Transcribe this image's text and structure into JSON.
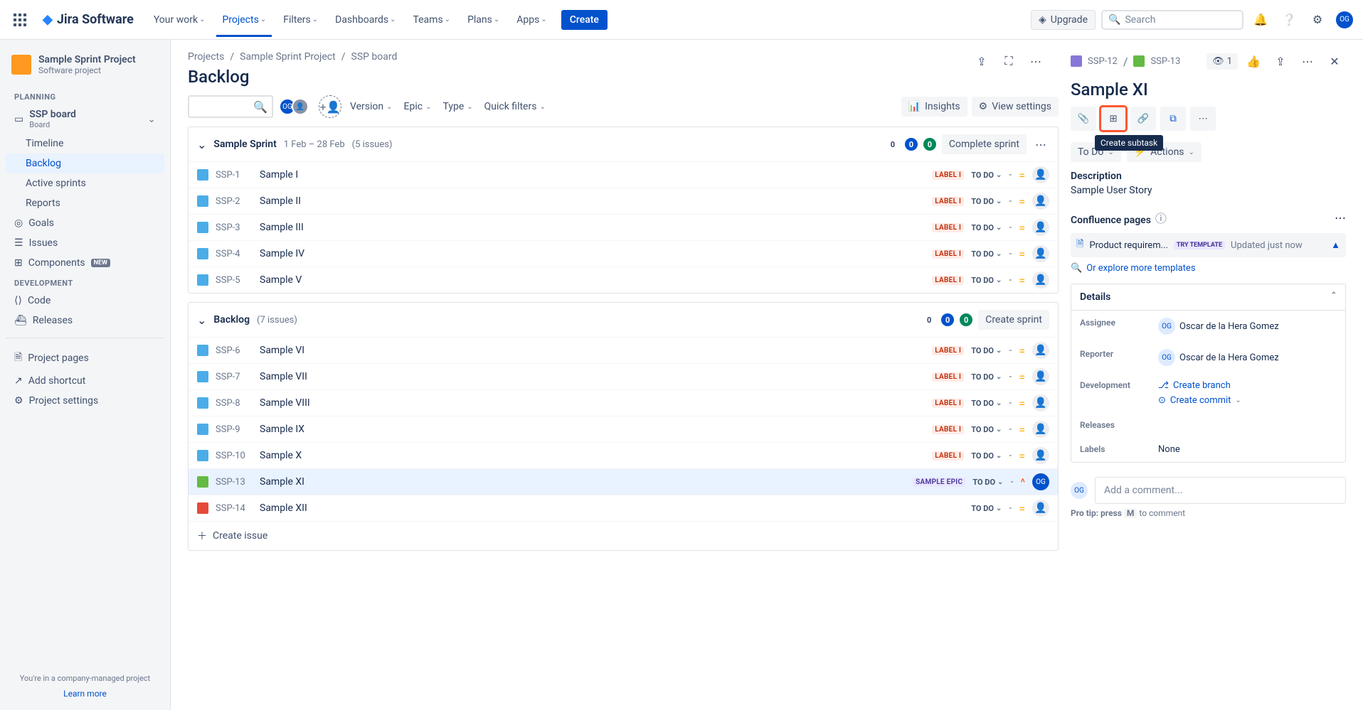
{
  "nav": {
    "logo_text": "Jira Software",
    "items": [
      "Your work",
      "Projects",
      "Filters",
      "Dashboards",
      "Teams",
      "Plans",
      "Apps"
    ],
    "active_index": 1,
    "create": "Create",
    "upgrade": "Upgrade",
    "search_placeholder": "Search"
  },
  "sidebar": {
    "project_name": "Sample Sprint Project",
    "project_sub": "Software project",
    "sections": {
      "planning": {
        "label": "PLANNING",
        "board_group": "SSP board",
        "board_sub": "Board",
        "items": [
          "Timeline",
          "Backlog",
          "Active sprints",
          "Reports"
        ],
        "selected": "Backlog",
        "goals": "Goals",
        "issues": "Issues",
        "components": "Components",
        "components_badge": "NEW"
      },
      "development": {
        "label": "DEVELOPMENT",
        "items": [
          "Code",
          "Releases"
        ]
      },
      "bottom": [
        "Project pages",
        "Add shortcut",
        "Project settings"
      ]
    },
    "footer_line": "You're in a company-managed project",
    "learn_more": "Learn more"
  },
  "breadcrumbs": [
    "Projects",
    "Sample Sprint Project",
    "SSP board"
  ],
  "page_title": "Backlog",
  "toolbar": {
    "filters": [
      "Version",
      "Epic",
      "Type",
      "Quick filters"
    ],
    "insights": "Insights",
    "view_settings": "View settings"
  },
  "sprints": [
    {
      "name": "Sample Sprint",
      "dates": "1 Feb – 28 Feb",
      "issue_count_label": "(5 issues)",
      "counts": {
        "todo": "0",
        "inprog": "0",
        "done": "0"
      },
      "action_label": "Complete sprint",
      "issues": [
        {
          "key": "SSP-1",
          "summary": "Sample I",
          "label": "LABEL I",
          "label_style": "red",
          "status": "TO DO",
          "type": "task",
          "prio": "med"
        },
        {
          "key": "SSP-2",
          "summary": "Sample II",
          "label": "LABEL I",
          "label_style": "red",
          "status": "TO DO",
          "type": "task",
          "prio": "med"
        },
        {
          "key": "SSP-3",
          "summary": "Sample III",
          "label": "LABEL I",
          "label_style": "red",
          "status": "TO DO",
          "type": "task",
          "prio": "med"
        },
        {
          "key": "SSP-4",
          "summary": "Sample IV",
          "label": "LABEL I",
          "label_style": "red",
          "status": "TO DO",
          "type": "task",
          "prio": "med"
        },
        {
          "key": "SSP-5",
          "summary": "Sample V",
          "label": "LABEL I",
          "label_style": "red",
          "status": "TO DO",
          "type": "task",
          "prio": "med"
        }
      ]
    },
    {
      "name": "Backlog",
      "dates": "",
      "issue_count_label": "(7 issues)",
      "counts": {
        "todo": "0",
        "inprog": "0",
        "done": "0"
      },
      "action_label": "Create sprint",
      "issues": [
        {
          "key": "SSP-6",
          "summary": "Sample VI",
          "label": "LABEL I",
          "label_style": "red",
          "status": "TO DO",
          "type": "task",
          "prio": "med"
        },
        {
          "key": "SSP-7",
          "summary": "Sample VII",
          "label": "LABEL I",
          "label_style": "red",
          "status": "TO DO",
          "type": "task",
          "prio": "med"
        },
        {
          "key": "SSP-8",
          "summary": "Sample VIII",
          "label": "LABEL I",
          "label_style": "red",
          "status": "TO DO",
          "type": "task",
          "prio": "med"
        },
        {
          "key": "SSP-9",
          "summary": "Sample IX",
          "label": "LABEL I",
          "label_style": "red",
          "status": "TO DO",
          "type": "task",
          "prio": "med"
        },
        {
          "key": "SSP-10",
          "summary": "Sample X",
          "label": "LABEL I",
          "label_style": "red",
          "status": "TO DO",
          "type": "task",
          "prio": "med"
        },
        {
          "key": "SSP-13",
          "summary": "Sample XI",
          "label": "SAMPLE EPIC",
          "label_style": "purple",
          "status": "TO DO",
          "type": "story",
          "prio": "high",
          "assignee": "OG",
          "selected": true
        },
        {
          "key": "SSP-14",
          "summary": "Sample XII",
          "label": "",
          "label_style": "",
          "status": "TO DO",
          "type": "bug",
          "prio": "med"
        }
      ],
      "create_issue": "Create issue"
    }
  ],
  "detail": {
    "parent_key": "SSP-12",
    "key": "SSP-13",
    "watchers": "1",
    "title": "Sample XI",
    "tooltip_create_subtask": "Create subtask",
    "status": "To Do",
    "actions": "Actions",
    "description_label": "Description",
    "description_text": "Sample User Story",
    "confluence": {
      "label": "Confluence pages",
      "row_title": "Product requirem...",
      "try_badge": "TRY TEMPLATE",
      "updated": "Updated just now",
      "explore": "Or explore more templates"
    },
    "details": {
      "header": "Details",
      "assignee_label": "Assignee",
      "assignee_value": "Oscar de la Hera Gomez",
      "reporter_label": "Reporter",
      "reporter_value": "Oscar de la Hera Gomez",
      "development_label": "Development",
      "create_branch": "Create branch",
      "create_commit": "Create commit",
      "releases_label": "Releases",
      "labels_label": "Labels",
      "labels_value": "None"
    },
    "comment_placeholder": "Add a comment...",
    "pro_tip_prefix": "Pro tip: press",
    "pro_tip_key": "M",
    "pro_tip_suffix": "to comment"
  }
}
